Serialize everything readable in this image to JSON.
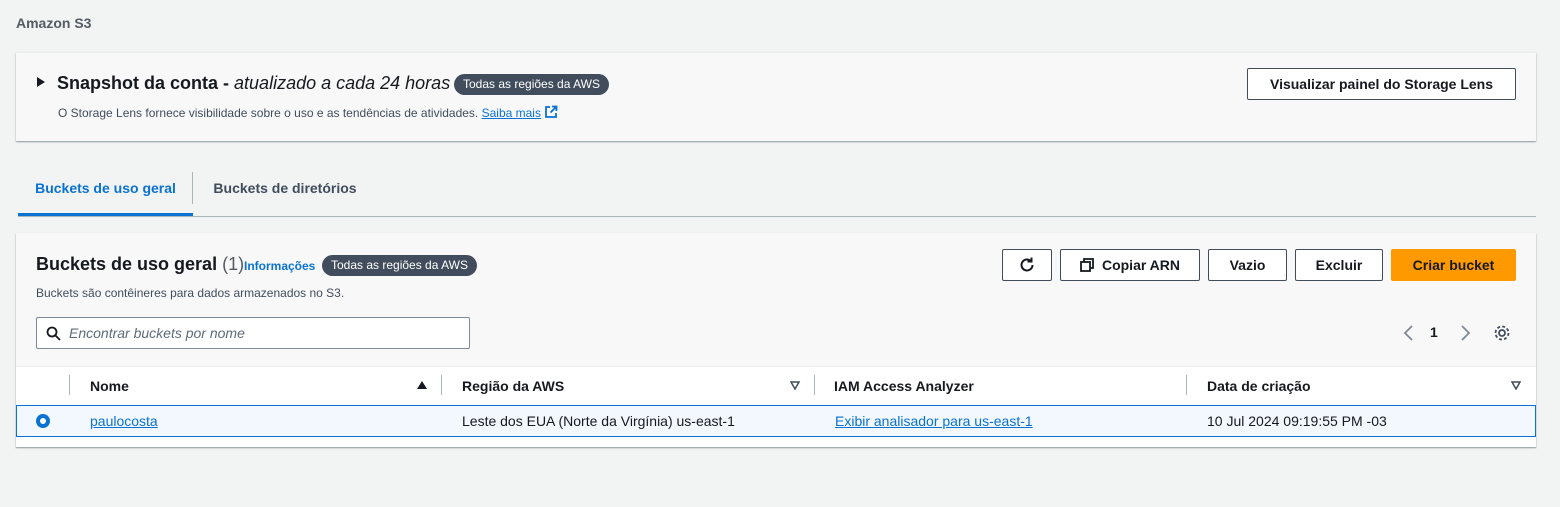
{
  "breadcrumb": "Amazon S3",
  "snapshot": {
    "title": "Snapshot da conta -",
    "subtitle": "atualizado a cada 24 horas",
    "badge": "Todas as regiões da AWS",
    "description": "O Storage Lens fornece visibilidade sobre o uso e as tendências de atividades.",
    "learn_more": "Saiba mais",
    "button": "Visualizar painel do Storage Lens"
  },
  "tabs": [
    {
      "label": "Buckets de uso geral",
      "active": true
    },
    {
      "label": "Buckets de diretórios",
      "active": false
    }
  ],
  "panel": {
    "title": "Buckets de uso geral",
    "count": "(1)",
    "info": "Informações",
    "badge": "Todas as regiões da AWS",
    "description": "Buckets são contêineres para dados armazenados no S3.",
    "buttons": {
      "copy_arn": "Copiar ARN",
      "empty": "Vazio",
      "delete": "Excluir",
      "create": "Criar bucket"
    },
    "search_placeholder": "Encontrar buckets por nome",
    "page": "1"
  },
  "table": {
    "columns": [
      "Nome",
      "Região da AWS",
      "IAM Access Analyzer",
      "Data de criação"
    ],
    "rows": [
      {
        "name": "paulocosta",
        "region": "Leste dos EUA (Norte da Virgínia) us-east-1",
        "analyzer": "Exibir analisador para us-east-1",
        "created": "10 Jul 2024 09:19:55 PM -03",
        "selected": true
      }
    ]
  },
  "colors": {
    "accent": "#0972d3",
    "primary_button": "#ff9900",
    "badge": "#414d5c",
    "background": "#f2f3f3"
  },
  "icons": [
    "external-link-icon",
    "refresh-icon",
    "copy-icon",
    "search-icon",
    "chevron-left-icon",
    "chevron-right-icon",
    "settings-icon",
    "sort-ascending-icon",
    "sort-descending-icon"
  ]
}
